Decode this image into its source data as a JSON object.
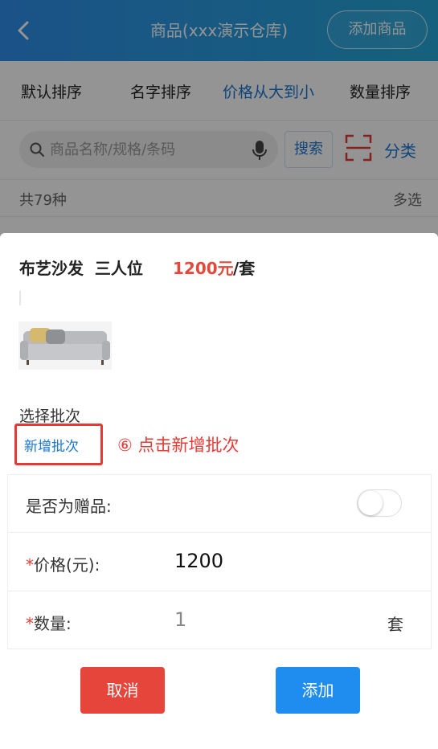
{
  "header": {
    "title": "商品(xxx演示仓库)",
    "add_button": "添加商品"
  },
  "sort_tabs": [
    {
      "label": "默认排序"
    },
    {
      "label": "名字排序"
    },
    {
      "label": "价格从大到小",
      "active": true
    },
    {
      "label": "数量排序"
    }
  ],
  "search": {
    "placeholder": "商品名称/规格/条码",
    "value": "",
    "button": "搜索",
    "category": "分类"
  },
  "list": {
    "count": "共79种",
    "multi_select": "多选"
  },
  "sheet": {
    "product_name": "布艺沙发  三人位",
    "price": "1200元",
    "unit": "/套",
    "batch_label": "选择批次",
    "new_batch": "新增批次",
    "annotation": "⑥ 点击新增批次",
    "form": {
      "gift_label": "是否为赠品:",
      "gift_on": false,
      "price_label": "价格(元):",
      "price_value": "1200",
      "qty_label": "数量:",
      "qty_value": "1",
      "qty_unit": "套"
    },
    "cancel": "取消",
    "add": "添加"
  },
  "colors": {
    "brand": "#2f8fea",
    "accent_blue": "#1976d2",
    "price_red": "#e04a3a",
    "annotation_red": "#e53935",
    "cancel_red": "#e5453a",
    "add_blue": "#1f8cf0"
  }
}
